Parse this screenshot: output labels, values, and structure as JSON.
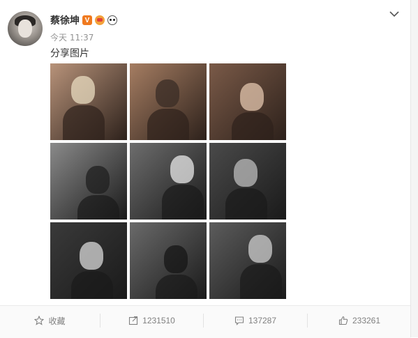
{
  "post": {
    "author": "蔡徐坤",
    "verified_badge": "V",
    "time": "今天 11:37",
    "text": "分享图片",
    "photo_count": 9
  },
  "photos": [
    {
      "name": "photo-1",
      "tone": "warm",
      "bg": "#b8937a",
      "accent": "#e9dcc0"
    },
    {
      "name": "photo-2",
      "tone": "warm",
      "bg": "#a57d62",
      "accent": "#3a2c25"
    },
    {
      "name": "photo-3",
      "tone": "warm",
      "bg": "#7a5a48",
      "accent": "#e3c5ad"
    },
    {
      "name": "photo-4",
      "tone": "mono",
      "bg": "#8a8a8a",
      "accent": "#1f1f1f"
    },
    {
      "name": "photo-5",
      "tone": "mono",
      "bg": "#6d6d6d",
      "accent": "#e8e8e8"
    },
    {
      "name": "photo-6",
      "tone": "mono",
      "bg": "#4a4a4a",
      "accent": "#bcbcbc"
    },
    {
      "name": "photo-7",
      "tone": "mono",
      "bg": "#3a3a3a",
      "accent": "#d8d8d8"
    },
    {
      "name": "photo-8",
      "tone": "mono",
      "bg": "#6a6a6a",
      "accent": "#151515"
    },
    {
      "name": "photo-9",
      "tone": "mono",
      "bg": "#5c5c5c",
      "accent": "#cfcfcf"
    }
  ],
  "actions": {
    "favorite_label": "收藏",
    "repost_count": "1231510",
    "comment_count": "137287",
    "like_count": "233261"
  },
  "colors": {
    "accent_orange": "#f07a1f",
    "muted_text": "#939393",
    "action_text": "#808080"
  }
}
